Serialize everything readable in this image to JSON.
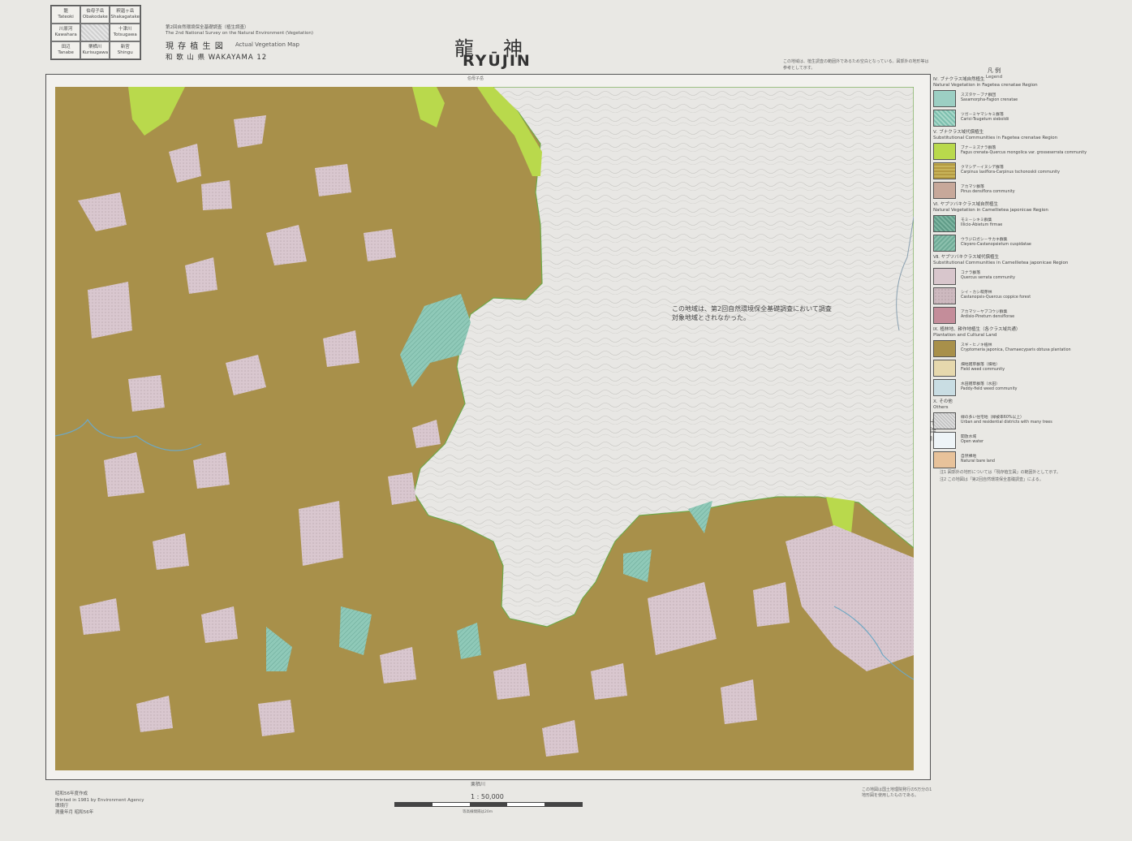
{
  "index_grid": [
    {
      "jp": "龍",
      "en": "Tateoki"
    },
    {
      "jp": "伯母子岳",
      "en": "Obakodake"
    },
    {
      "jp": "釈迦ヶ岳",
      "en": "Shakagatake"
    },
    {
      "jp": "川原河",
      "en": "Kawahara"
    },
    {
      "jp": "",
      "en": ""
    },
    {
      "jp": "十津川",
      "en": "Totsugawa"
    },
    {
      "jp": "田辺",
      "en": "Tanabe"
    },
    {
      "jp": "栗栖川",
      "en": "Kurisugawa"
    },
    {
      "jp": "新宮",
      "en": "Shingu"
    }
  ],
  "header": {
    "survey_line": "第2回自然環境保全基礎調査（植生調査）",
    "survey_line_en": "The 2nd National Survey on the Natural Environment (Vegetation)",
    "map_type_jp": "現 存 植 生 図",
    "map_type_en": "Actual Vegetation Map",
    "sheet_id": "和 歌 山 県  WAKAYAMA 12"
  },
  "title": {
    "kanji": "龍神",
    "roman": "RYŪJIN"
  },
  "top_note": "この地域は、植生調査の範囲外であるため空白となっている。図郭外の地形等は参考として示す。",
  "map": {
    "top_label_center": "伯母子岳",
    "bottom_label_center": "栗栖川",
    "right_label_river": "十津川",
    "center_note": "この地域は、第2回自然環境保全基礎調査において調査対象地域とされなかった。",
    "colors": {
      "plantation": "#a8904a",
      "coppice": "#d9c7cf",
      "beech_natural": "#8fc9b8",
      "beech_substitute": "#b5d34a",
      "unsurveyed": "#e8e7e4",
      "frame": "#555555"
    }
  },
  "legend": {
    "title_jp": "凡 例",
    "title_en": "Legend",
    "sections": [
      {
        "label": "Ⅳ. ブナクラス域自然植生\nNatural Vegetation in Fagetea crenatae Region",
        "items": [
          {
            "color": "#9ccfc3",
            "code": "",
            "text": "スズタケ－ブナ群団\nSasamorpha-Fagion crenatae"
          },
          {
            "color": "#7dbfae",
            "code": "",
            "text": "ツガ－ミヤマシキミ群落\nCarici-Tsugetum sieboldii"
          }
        ]
      },
      {
        "label": "Ⅴ. ブナクラス域代償植生\nSubstitutional Communities in Fagetea crenatae Region",
        "items": [
          {
            "color": "#b9d94c",
            "code": "",
            "text": "ブナ－ミズナラ群落\nFagus crenata-Quercus mongolica var. grosseserrata community"
          },
          {
            "color": "#b49a42",
            "code": "",
            "text": "クマシデ－イヌシデ群落\nCarpinus laxiflora-Carpinus tschonoskii community"
          },
          {
            "color": "#c7a89a",
            "code": "",
            "text": "アカマツ群落\nPinus densiflora community"
          }
        ]
      },
      {
        "label": "Ⅵ. ヤブツバキクラス域自然植生\nNatural Vegetation in Camellietea japonicae Region",
        "items": [
          {
            "color": "#5e9a86",
            "code": "",
            "text": "モミ－シキミ群集\nIllicio-Abietum firmae"
          },
          {
            "color": "#6fab97",
            "code": "",
            "text": "ウラジロガシ－サカキ群集\nCleyero-Castanopsietum cuspidatae"
          }
        ]
      },
      {
        "label": "Ⅶ. ヤブツバキクラス域代償植生\nSubstitutional Communities in Camellietea japonicae Region",
        "items": [
          {
            "color": "#d8c6cc",
            "code": "",
            "text": "コナラ群落\nQuercus serrata community"
          },
          {
            "color": "#cdb9bf",
            "code": "",
            "text": "シイ・カシ萌芽林\nCastanopsis-Quercus coppice forest"
          },
          {
            "color": "#c48d9a",
            "code": "",
            "text": "アカマツ－ヤブコウジ群集\nArdisio-Pinetum densiflorae"
          }
        ]
      },
      {
        "label": "Ⅸ. 植林地、耕作地植生（各クラス域共通）\nPlantation and Cultural Land",
        "items": [
          {
            "color": "#a8904a",
            "code": "",
            "text": "スギ・ヒノキ植林\nCryptomeria japonica, Chamaecyparis obtusa plantation"
          },
          {
            "color": "#e6d8ad",
            "code": "",
            "text": "畑地雑草群落（畑地）\nField weed community"
          },
          {
            "color": "#c9dde3",
            "code": "",
            "text": "水田雑草群落（水田）\nPaddy-field weed community"
          }
        ]
      },
      {
        "label": "Ⅹ. その他\nOthers",
        "items": [
          {
            "color": "#dcdcdc",
            "code": "",
            "text": "緑の多い住宅地（緑被率60%以上）\nUrban and residential districts with many trees"
          },
          {
            "color": "#eef4f7",
            "code": "",
            "text": "開放水域\nOpen water"
          },
          {
            "color": "#e8c29a",
            "code": "",
            "text": "自然裸地\nNatural bare land"
          }
        ]
      }
    ],
    "notes": [
      "注1 図郭外の地形については「現存植生図」の範囲外として示す。",
      "注2 この地図は「第2回自然環境保全基礎調査」による。"
    ]
  },
  "scale": {
    "label": "1 : 50,000",
    "caption": "等高線間隔は20m"
  },
  "publisher": [
    "昭和56年度作成",
    "Printed in 1981 by Environment Agency",
    "環境庁",
    "測量年月  昭和56年"
  ],
  "bottom_right": "この地図は国土地理院発行の5万分の1地形図を使用したものである。"
}
